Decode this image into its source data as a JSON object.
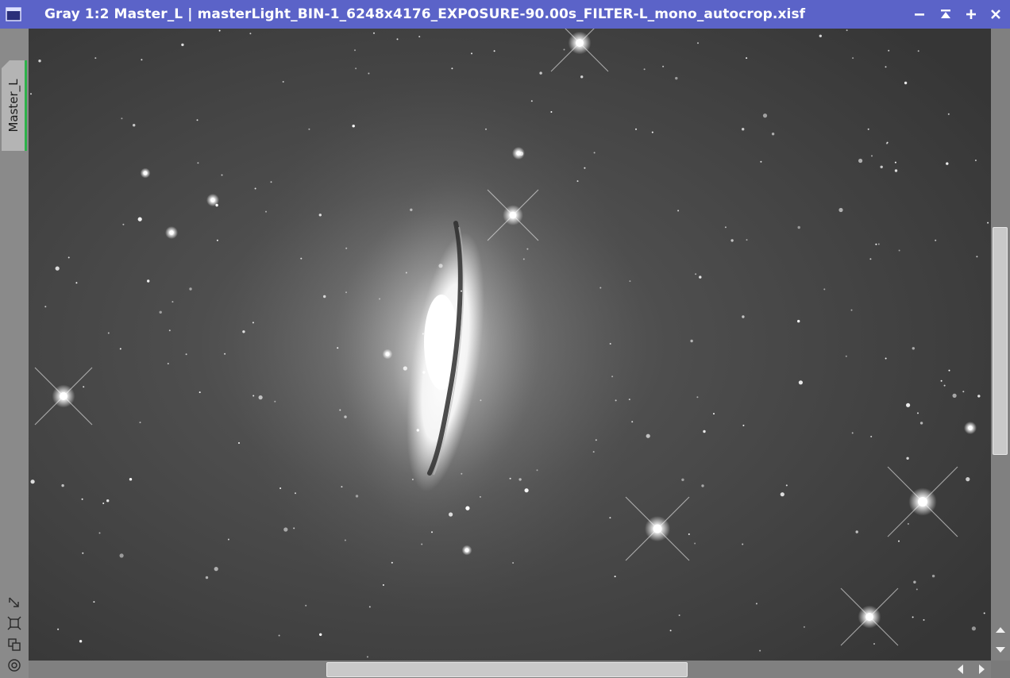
{
  "window": {
    "title": "Gray 1:2 Master_L | masterLight_BIN-1_6248x4176_EXPOSURE-90.00s_FILTER-L_mono_autocrop.xisf",
    "icon": "window-icon",
    "controls": [
      "minimize-icon",
      "shade-icon",
      "maximize-icon",
      "close-icon"
    ],
    "titlebar_color": "#5b63c8"
  },
  "sidebar": {
    "tab_label": "Master_L",
    "tab_accent": "#2db24a",
    "tools": [
      "fit-view-icon",
      "zoom-fit-icon",
      "clone-icon",
      "target-icon"
    ]
  },
  "image": {
    "subject": "sombrero-galaxy-image"
  },
  "scrollbars": {
    "vertical_arrows": [
      "scroll-up-icon",
      "scroll-down-icon"
    ],
    "horizontal_arrows": [
      "scroll-left-icon",
      "scroll-right-icon"
    ]
  }
}
